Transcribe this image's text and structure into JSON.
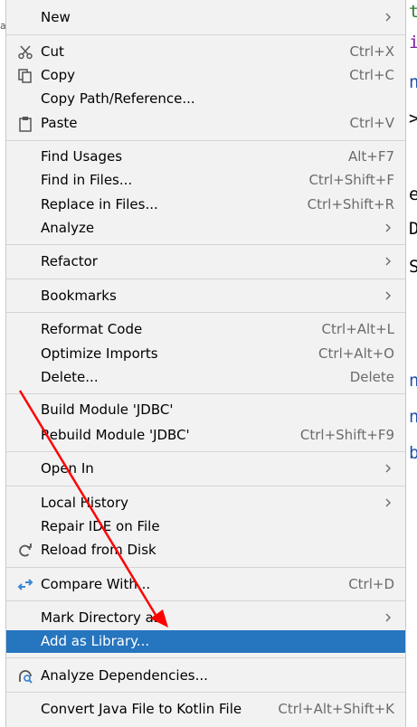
{
  "editor_glyphs": [
    {
      "char": "t",
      "color": "#2b7a2b"
    },
    {
      "char": "i",
      "color": "#7a1f9c"
    },
    {
      "char": "n",
      "color": "#1f4fa6"
    },
    {
      "char": ">",
      "color": "#000000"
    },
    {
      "char": "e",
      "color": "#000000"
    },
    {
      "char": "D",
      "color": "#000000"
    },
    {
      "char": "S",
      "color": "#000000"
    },
    {
      "char": "n",
      "color": "#1f4fa6"
    },
    {
      "char": "n",
      "color": "#1f4fa6"
    },
    {
      "char": "b",
      "color": "#1f4fa6"
    }
  ],
  "left_fragment": "a",
  "menu": {
    "new_label": "New",
    "cut_label": "Cut",
    "cut_shortcut": "Ctrl+X",
    "copy_label": "Copy",
    "copy_shortcut": "Ctrl+C",
    "copy_path_label": "Copy Path/Reference...",
    "paste_label": "Paste",
    "paste_shortcut": "Ctrl+V",
    "find_usages_label": "Find Usages",
    "find_usages_shortcut": "Alt+F7",
    "find_in_files_label": "Find in Files...",
    "find_in_files_shortcut": "Ctrl+Shift+F",
    "replace_in_files_label": "Replace in Files...",
    "replace_in_files_shortcut": "Ctrl+Shift+R",
    "analyze_label": "Analyze",
    "refactor_label": "Refactor",
    "bookmarks_label": "Bookmarks",
    "reformat_label": "Reformat Code",
    "reformat_shortcut": "Ctrl+Alt+L",
    "optimize_label": "Optimize Imports",
    "optimize_shortcut": "Ctrl+Alt+O",
    "delete_label": "Delete...",
    "delete_shortcut": "Delete",
    "build_label": "Build Module 'JDBC'",
    "rebuild_label": "Rebuild Module 'JDBC'",
    "rebuild_shortcut": "Ctrl+Shift+F9",
    "open_in_label": "Open In",
    "local_history_label": "Local History",
    "repair_ide_label": "Repair IDE on File",
    "reload_label": "Reload from Disk",
    "compare_label": "Compare With...",
    "compare_shortcut": "Ctrl+D",
    "mark_dir_label": "Mark Directory as",
    "add_library_label": "Add as Library...",
    "analyze_deps_label": "Analyze Dependencies...",
    "convert_label": "Convert Java File to Kotlin File",
    "convert_shortcut": "Ctrl+Alt+Shift+K"
  },
  "colors": {
    "selected_bg": "#2675bf",
    "annotation_arrow": "#ff0000"
  },
  "icons": {
    "cut": "scissors-icon",
    "copy": "copy-icon",
    "paste": "clipboard-icon",
    "reload": "reload-icon",
    "compare": "compare-arrows-icon",
    "analyze_deps": "analyze-dependencies-icon",
    "submenu": "chevron-right-icon"
  }
}
